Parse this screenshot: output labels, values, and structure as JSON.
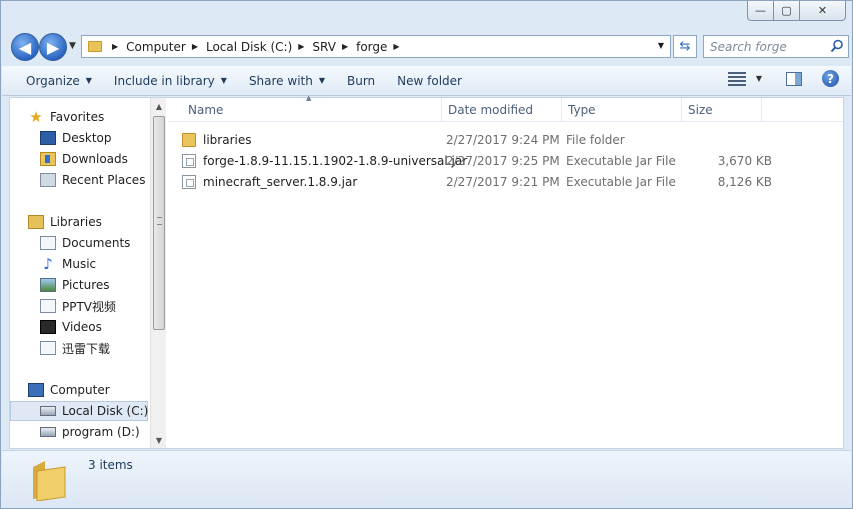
{
  "window": {
    "caption": {
      "minimize": "—",
      "maximize": "▢",
      "close": "✕"
    }
  },
  "nav": {
    "back_glyph": "◀",
    "forward_glyph": "▶",
    "breadcrumbs": [
      "Computer",
      "Local Disk (C:)",
      "SRV",
      "forge"
    ],
    "search_placeholder": "Search forge"
  },
  "commands": [
    {
      "label": "Organize",
      "dropdown": true
    },
    {
      "label": "Include in library",
      "dropdown": true
    },
    {
      "label": "Share with",
      "dropdown": true
    },
    {
      "label": "Burn",
      "dropdown": false
    },
    {
      "label": "New folder",
      "dropdown": false
    }
  ],
  "sidebar": {
    "favorites": {
      "label": "Favorites",
      "items": [
        "Desktop",
        "Downloads",
        "Recent Places"
      ]
    },
    "libraries": {
      "label": "Libraries",
      "items": [
        "Documents",
        "Music",
        "Pictures",
        "PPTV视频",
        "Videos",
        "迅雷下载"
      ]
    },
    "computer": {
      "label": "Computer",
      "items": [
        "Local Disk (C:)",
        "program (D:)"
      ]
    }
  },
  "columns": {
    "name": "Name",
    "date": "Date modified",
    "type": "Type",
    "size": "Size"
  },
  "files": [
    {
      "name": "libraries",
      "date": "2/27/2017 9:24 PM",
      "type": "File folder",
      "size": "",
      "kind": "folder"
    },
    {
      "name": "forge-1.8.9-11.15.1.1902-1.8.9-universal.jar",
      "date": "2/27/2017 9:25 PM",
      "type": "Executable Jar File",
      "size": "3,670 KB",
      "kind": "jar"
    },
    {
      "name": "minecraft_server.1.8.9.jar",
      "date": "2/27/2017 9:21 PM",
      "type": "Executable Jar File",
      "size": "8,126 KB",
      "kind": "jar"
    }
  ],
  "status": {
    "item_count": "3 items"
  },
  "colors": {
    "folder": "#e9c45a",
    "accent": "#2b66c4",
    "chrome": "#dde9f5"
  }
}
